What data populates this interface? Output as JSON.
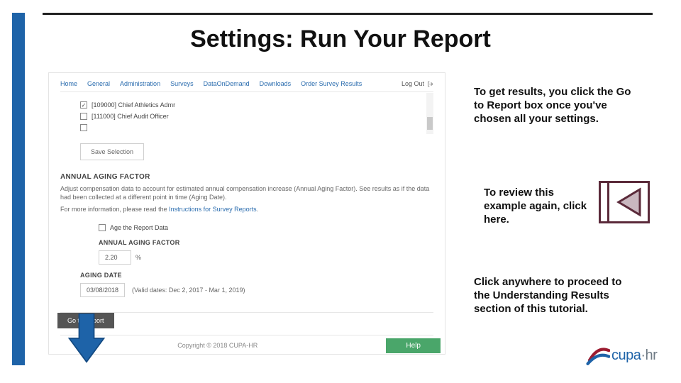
{
  "title": "Settings: Run Your Report",
  "nav": {
    "items": [
      "Home",
      "General",
      "Administration",
      "Surveys",
      "DataOnDemand",
      "Downloads",
      "Order Survey Results"
    ],
    "logout": "Log Out"
  },
  "selections": {
    "row1_checked": true,
    "row1_label": "[109000] Chief Athletics Admr",
    "row2_checked": false,
    "row2_label": "[111000] Chief Audit Officer"
  },
  "save_label": "Save Selection",
  "aging": {
    "head": "ANNUAL AGING FACTOR",
    "para": "Adjust compensation data to account for estimated annual compensation increase (Annual Aging Factor). See results as if the data had been collected at a different point in time (Aging Date).",
    "more_info_prefix": "For more information, please read the ",
    "more_info_link": "Instructions for Survey Reports",
    "more_info_suffix": ".",
    "age_checkbox_label": "Age the Report Data",
    "factor_head": "ANNUAL AGING FACTOR",
    "factor_value": "2.20",
    "factor_suffix": "%",
    "date_head": "AGING DATE",
    "date_value": "03/08/2018",
    "date_hint": "(Valid dates: Dec 2, 2017 - Mar 1, 2019)"
  },
  "go_report_label": "Go to Report",
  "footer": {
    "copyright": "Copyright © 2018 CUPA-HR",
    "help": "Help"
  },
  "callouts": {
    "c1": "To get results, you click the Go to Report box once you've chosen all your settings.",
    "c2": "To review this example again, click here.",
    "c3": "Click anywhere to proceed to the Understanding Results section of this tutorial."
  },
  "logo": {
    "part1": "cupa",
    "part2": "·hr"
  }
}
